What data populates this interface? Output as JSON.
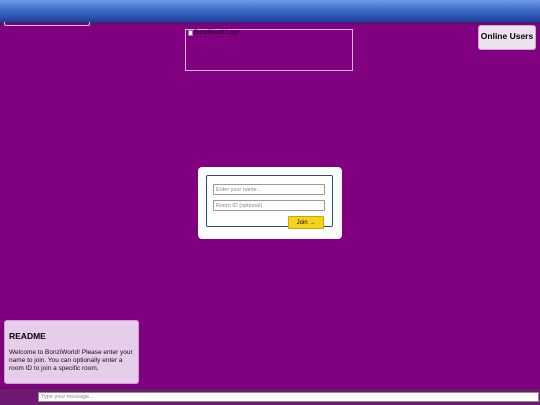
{
  "logo": {
    "alt_text": "BonziWorld Logo",
    "icon": "broken-image-icon"
  },
  "online_users": {
    "title": "Online Users"
  },
  "login": {
    "name_placeholder": "Enter your name...",
    "room_placeholder": "Room ID (optional)",
    "join_label": "Join →"
  },
  "readme": {
    "title": "README",
    "body": "Welcome to BonziWorld! Please enter your name to join. You can optionally enter a room ID to join a specific room."
  },
  "chat": {
    "placeholder": "Type your message..."
  },
  "colors": {
    "background": "#800080",
    "topbar": "#3f6dc9",
    "join_button": "#f7d21a",
    "readme_panel": "#e6cde9"
  }
}
